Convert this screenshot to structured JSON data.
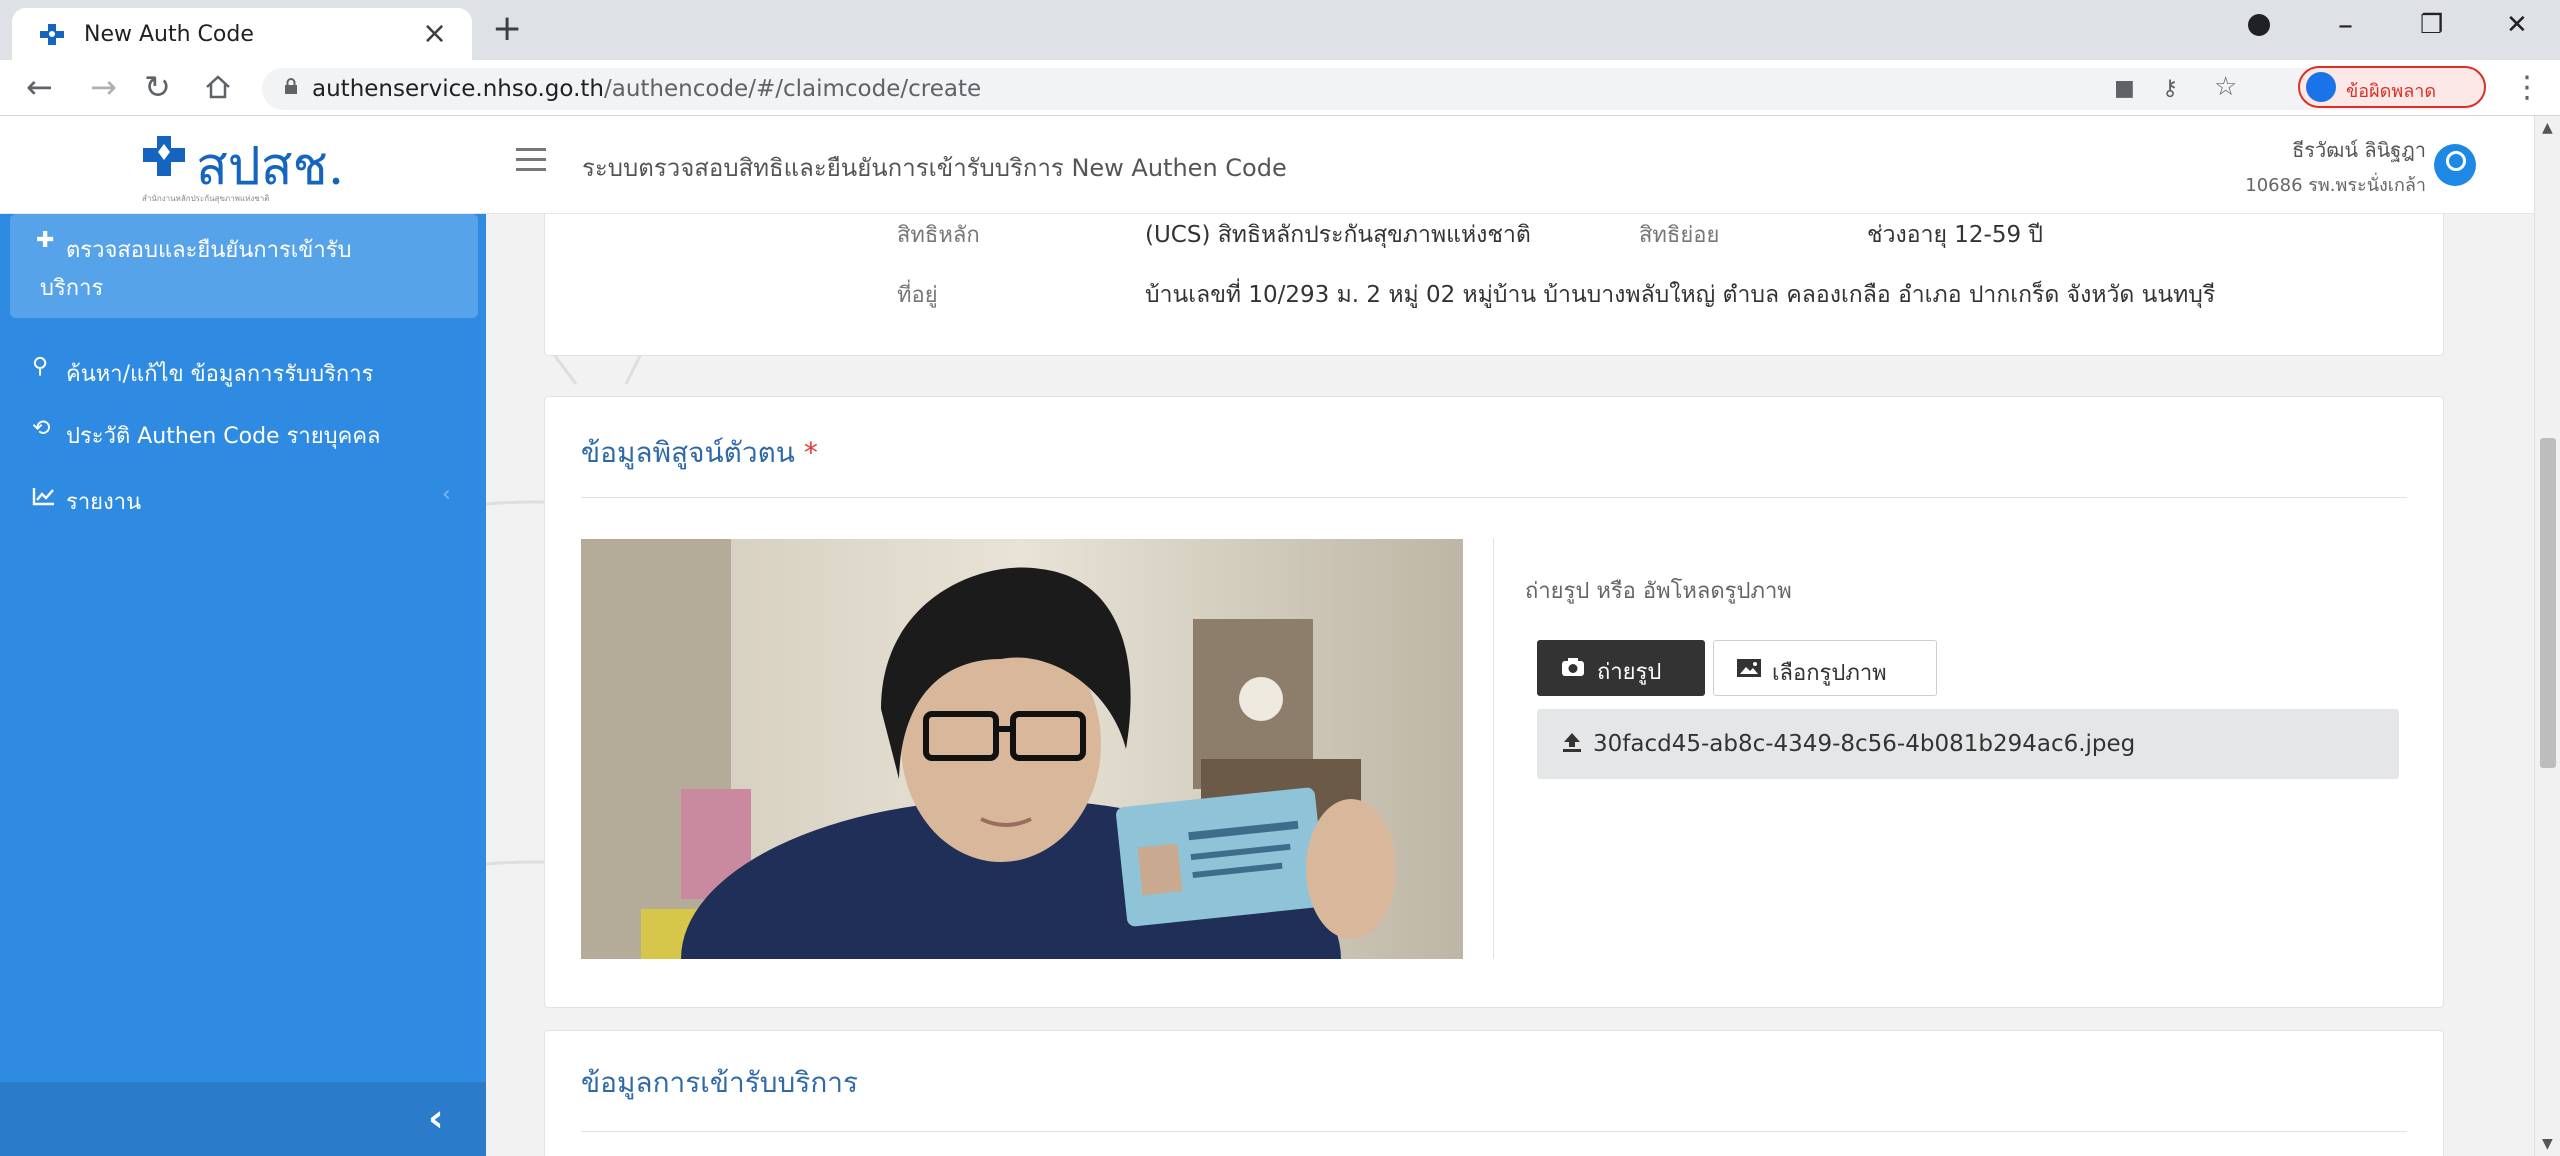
{
  "browser": {
    "tab_title": "New Auth Code",
    "tab_close": "×",
    "new_tab": "+",
    "url_host": "authenservice.nhso.go.th",
    "url_path": "/authencode/#/claimcode/create",
    "profile_label": "ข้อผิดพลาด",
    "window_controls": {
      "minimize": "–",
      "restore": "❐",
      "close": "✕"
    }
  },
  "header": {
    "logo_text": "สปสช.",
    "logo_subtext": "สำนักงานหลักประกันสุขภาพแห่งชาติ",
    "title": "ระบบตรวจสอบสิทธิและยืนยันการเข้ารับบริการ New Authen Code",
    "user_name": "ธีรวัฒน์ ลินิฐฎา",
    "user_unit": "10686 รพ.พระนั่งเกล้า"
  },
  "sidebar": {
    "items": [
      {
        "icon": "plus-cross-icon",
        "label_line1": "ตรวจสอบและยืนยันการเข้ารับ",
        "label_line2": "บริการ"
      },
      {
        "icon": "search-icon",
        "label": "ค้นหา/แก้ไข ข้อมูลการรับบริการ"
      },
      {
        "icon": "history-icon",
        "label": "ประวัติ Authen Code รายบุคคล"
      },
      {
        "icon": "chart-line-icon",
        "label": "รายงาน",
        "chevron": "‹"
      }
    ],
    "collapse_label": "‹"
  },
  "patient_info": {
    "right_label": "สิทธิหลัก",
    "right_value": "(UCS) สิทธิหลักประกันสุขภาพแห่งชาติ",
    "subright_label": "สิทธิย่อย",
    "subright_value": "ช่วงอายุ 12-59 ปี",
    "address_label": "ที่อยู่",
    "address_value": "บ้านเลขที่ 10/293 ม. 2 หมู่ 02 หมู่บ้าน บ้านบางพลับใหญ่ ตำบล คลองเกลือ อำเภอ ปากเกร็ด จังหวัด นนทบุรี"
  },
  "identity": {
    "title": "ข้อมูลพิสูจน์ตัวตน",
    "required_mark": "*",
    "upload_hint": "ถ่ายรูป หรือ อัพโหลดรูปภาพ",
    "camera_button": "ถ่ายรูป",
    "pick_button": "เลือกรูปภาพ",
    "file_name": "30facd45-ab8c-4349-8c56-4b081b294ac6.jpeg"
  },
  "service": {
    "title": "ข้อมูลการเข้ารับบริการ"
  }
}
